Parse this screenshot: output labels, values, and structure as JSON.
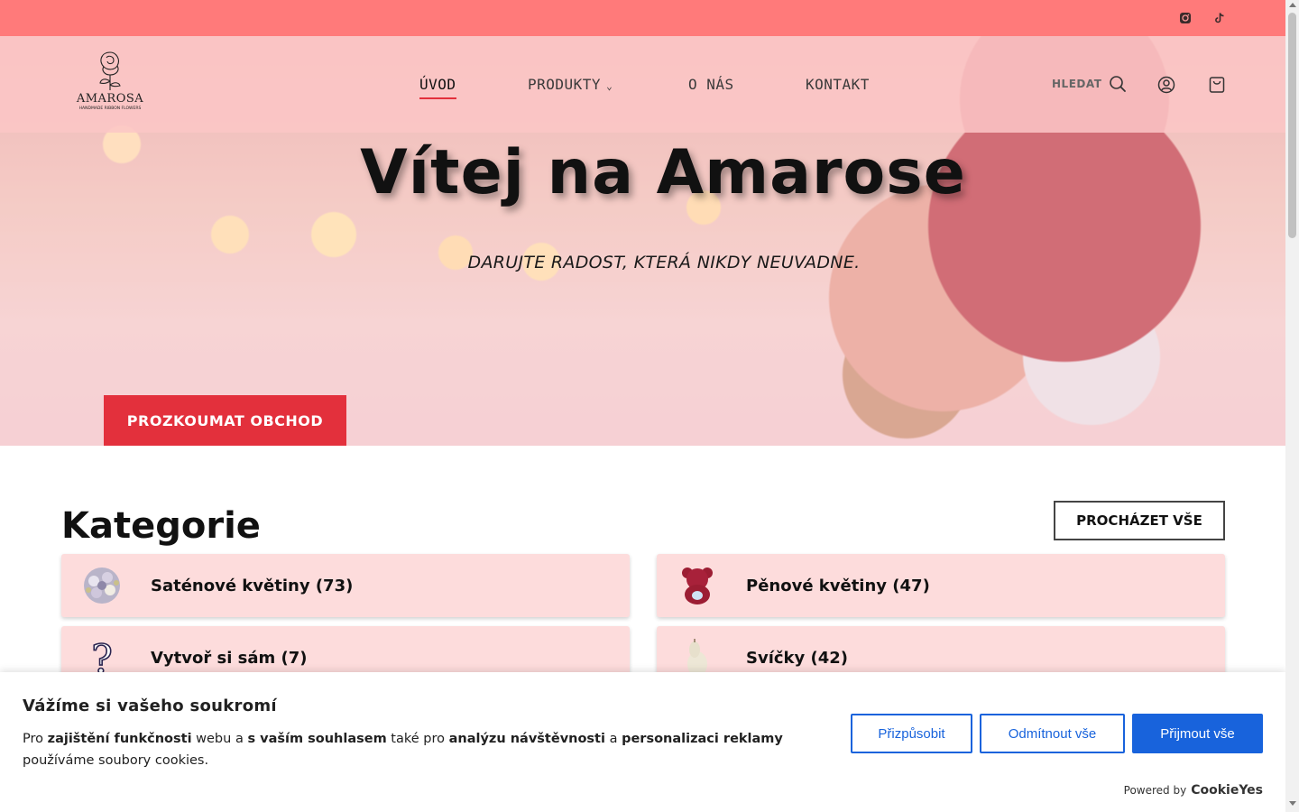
{
  "topbar": {
    "social": [
      "instagram-icon",
      "tiktok-icon"
    ],
    "color": "#ff7a7a"
  },
  "header": {
    "logo": {
      "name": "AMAROSA",
      "tagline": "HANDMADE RIBBON FLOWERS"
    },
    "nav": {
      "home": "ÚVOD",
      "products": "PRODUKTY",
      "about": "O NÁS",
      "contact": "KONTAKT"
    },
    "search_label": "HLEDAT",
    "accent": "#e3303c"
  },
  "hero": {
    "title": "Vítej na Amarose",
    "subtitle": "DARUJTE RADOST, KTERÁ NIKDY NEUVADNE.",
    "cta": "PROZKOUMAT OBCHOD"
  },
  "categories": {
    "title": "Kategorie",
    "browse_all": "PROCHÁZET VŠE",
    "items": [
      {
        "label": "Saténové květiny (73)",
        "icon": "satin-bouquet-thumbnail"
      },
      {
        "label": "Pěnové květiny (47)",
        "icon": "foam-bear-thumbnail"
      },
      {
        "label": "Vytvoř si sám (7)",
        "icon": "question-mark-thumbnail"
      },
      {
        "label": "Svíčky (42)",
        "icon": "candle-thumbnail"
      }
    ]
  },
  "cookie": {
    "title": "Vážíme si vašeho soukromí",
    "text_parts": {
      "p1": "Pro ",
      "b1": "zajištění funkčnosti",
      "p2": " webu a ",
      "b2": "s vaším souhlasem",
      "p3": " také pro ",
      "b3": "analýzu návštěvnosti",
      "p4": " a ",
      "b4": "personalizaci reklamy",
      "p5": " používáme soubory cookies."
    },
    "customize": "Přizpůsobit",
    "reject": "Odmítnout vše",
    "accept": "Přijmout vše",
    "powered_by": "Powered by",
    "brand": "CookieYes",
    "button_color": "#1863dc"
  }
}
